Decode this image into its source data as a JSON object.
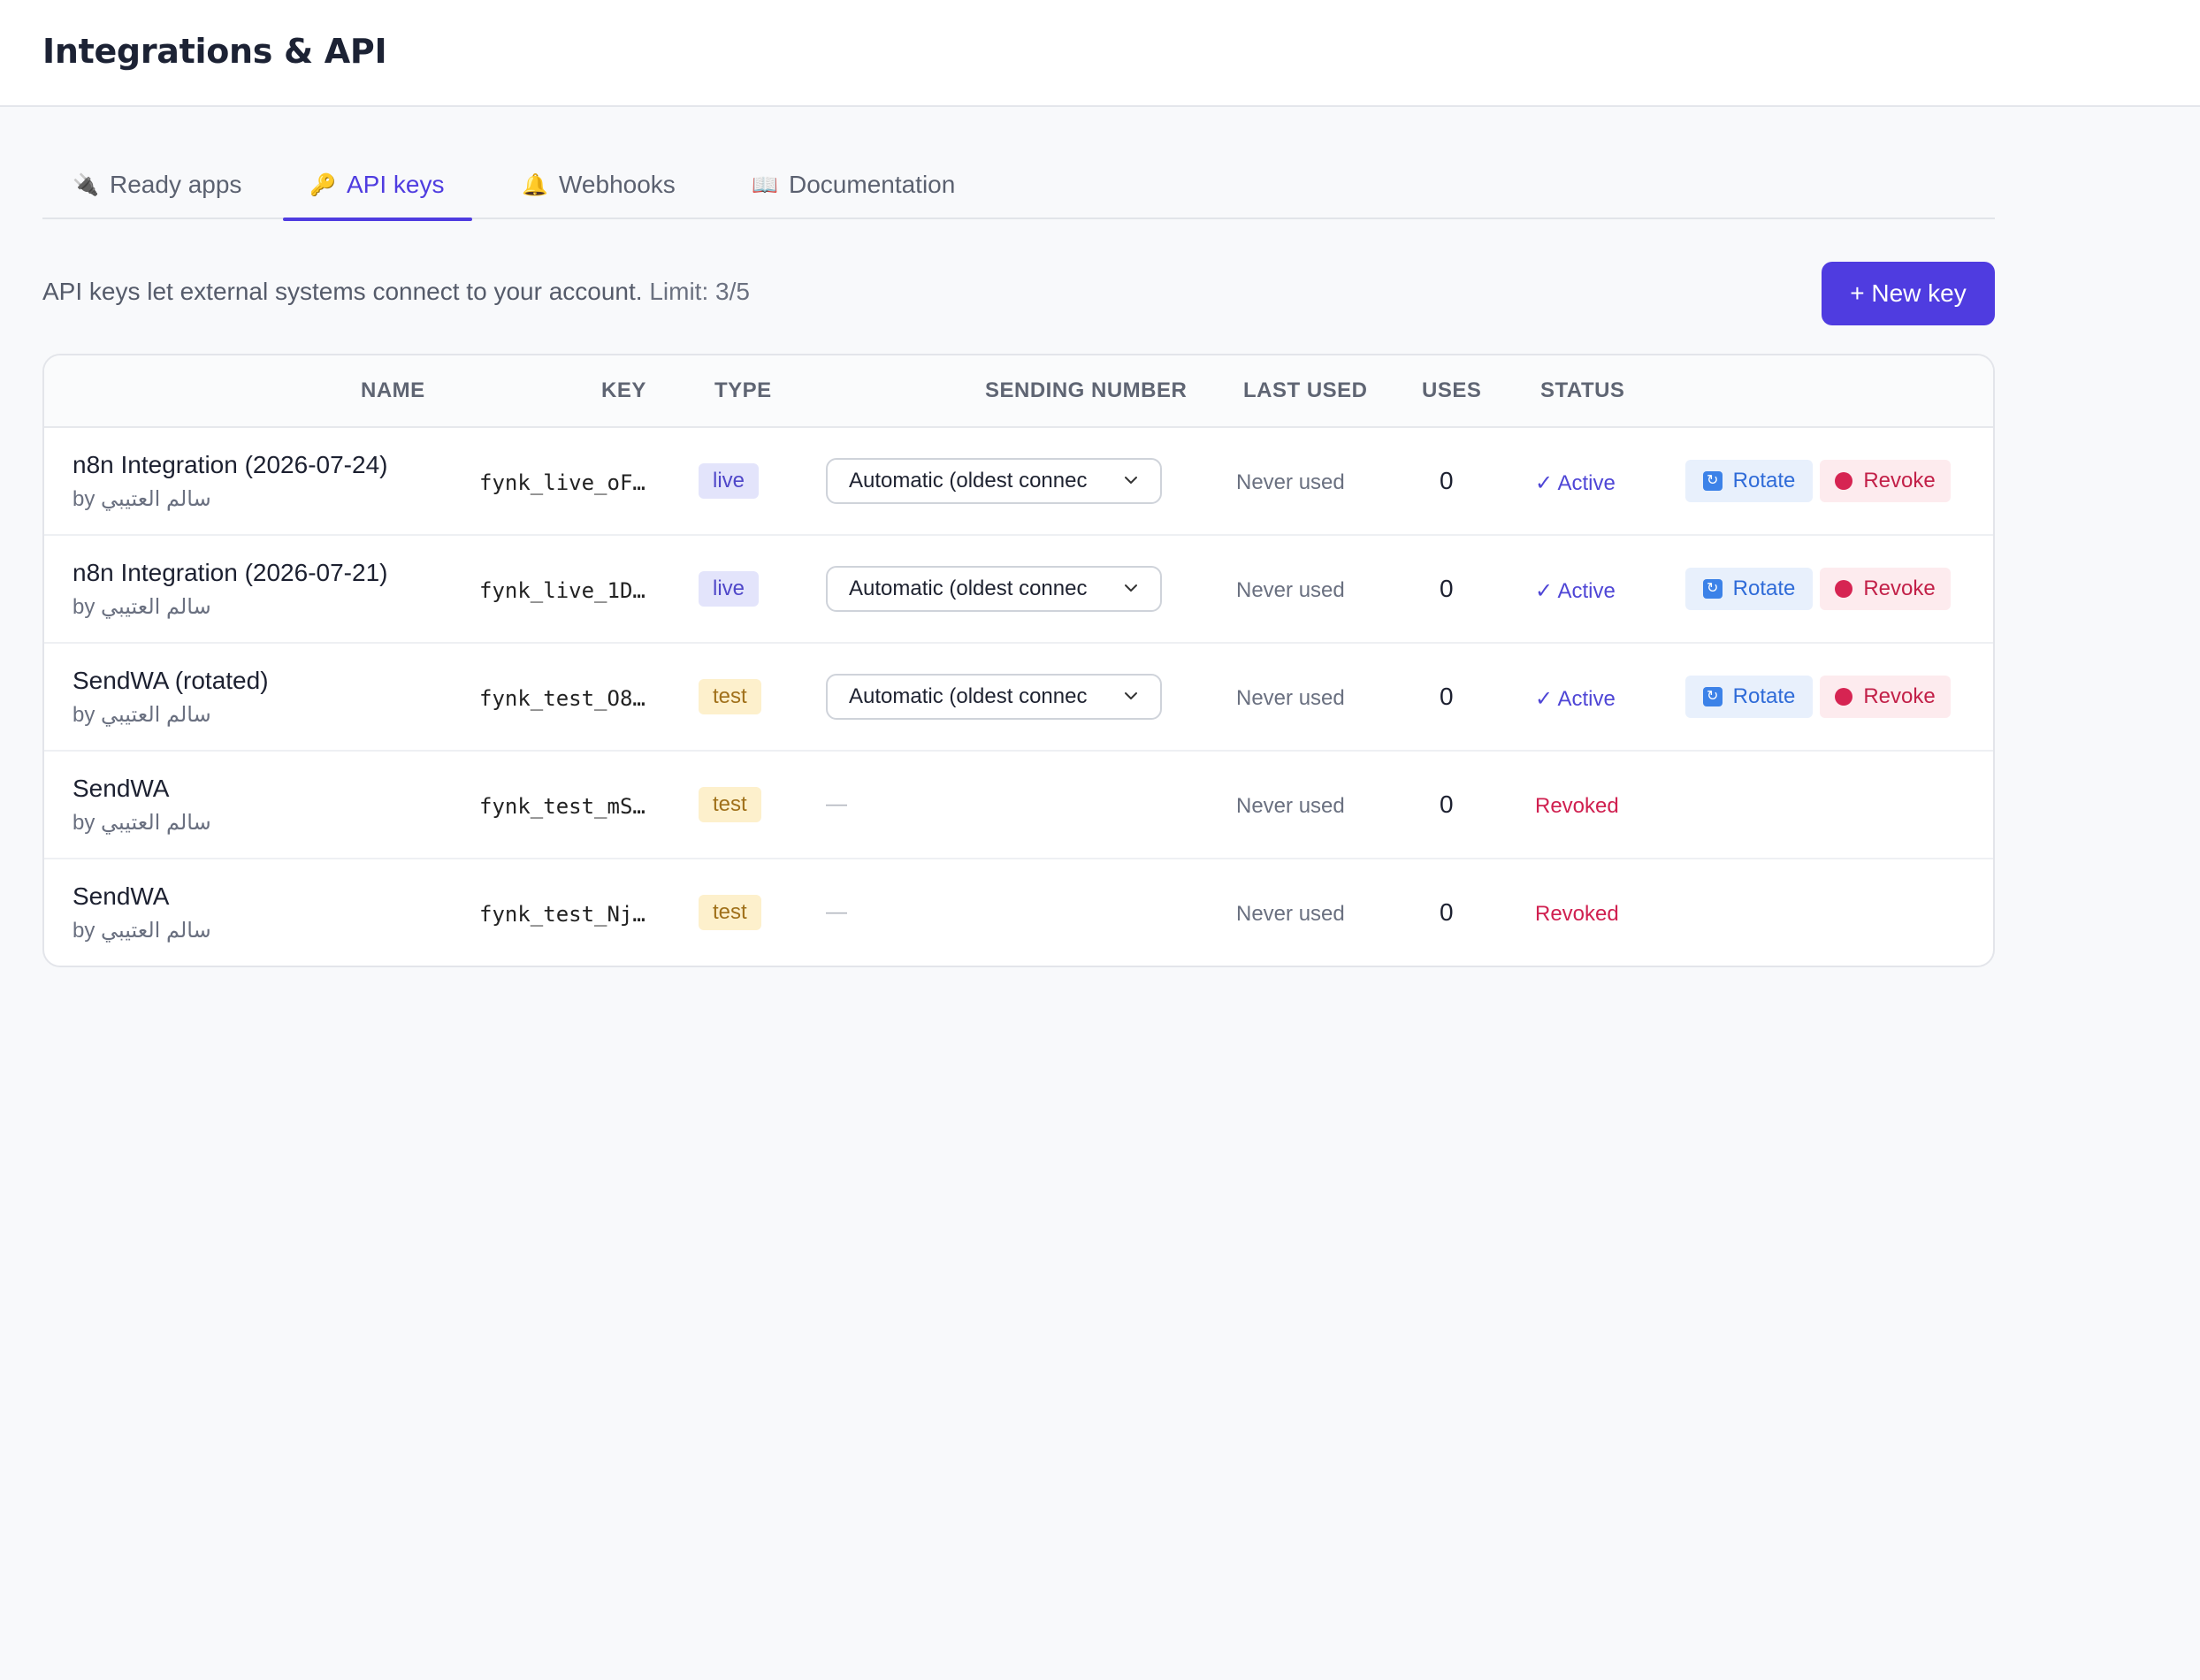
{
  "header": {
    "title": "Integrations & API"
  },
  "tabs": [
    {
      "icon": "plug-icon",
      "glyph": "🔌",
      "label": "Ready apps",
      "active": false
    },
    {
      "icon": "key-icon",
      "glyph": "🔑",
      "label": "API keys",
      "active": true
    },
    {
      "icon": "bell-icon",
      "glyph": "🔔",
      "label": "Webhooks",
      "active": false
    },
    {
      "icon": "book-icon",
      "glyph": "📖",
      "label": "Documentation",
      "active": false
    }
  ],
  "intro": {
    "text": "API keys let external systems connect to your account.",
    "limit": "Limit: 3/5"
  },
  "new_key_button": "+ New key",
  "table": {
    "headers": {
      "name": "NAME",
      "key": "KEY",
      "type": "TYPE",
      "sending_number": "SENDING NUMBER",
      "last_used": "LAST USED",
      "uses": "USES",
      "status": "STATUS"
    },
    "rows": [
      {
        "name": "n8n Integration (2026-07-24)",
        "by": "by سالم العتيبي",
        "key": "fynk_live_oF…",
        "type": "live",
        "sending_number": "Automatic (oldest connec",
        "last_used": "Never used",
        "uses": "0",
        "status": "✓ Active",
        "rotate": "Rotate",
        "revoke": "Revoke"
      },
      {
        "name": "n8n Integration (2026-07-21)",
        "by": "by سالم العتيبي",
        "key": "fynk_live_1D…",
        "type": "live",
        "sending_number": "Automatic (oldest connec",
        "last_used": "Never used",
        "uses": "0",
        "status": "✓ Active",
        "rotate": "Rotate",
        "revoke": "Revoke"
      },
      {
        "name": "SendWA (rotated)",
        "by": "by سالم العتيبي",
        "key": "fynk_test_O8…",
        "type": "test",
        "sending_number": "Automatic (oldest connec",
        "last_used": "Never used",
        "uses": "0",
        "status": "✓ Active",
        "rotate": "Rotate",
        "revoke": "Revoke"
      },
      {
        "name": "SendWA",
        "by": "by سالم العتيبي",
        "key": "fynk_test_mS…",
        "type": "test",
        "sending_number": "—",
        "last_used": "Never used",
        "uses": "0",
        "status": "Revoked"
      },
      {
        "name": "SendWA",
        "by": "by سالم العتيبي",
        "key": "fynk_test_Nj…",
        "type": "test",
        "sending_number": "—",
        "last_used": "Never used",
        "uses": "0",
        "status": "Revoked"
      }
    ]
  },
  "colors": {
    "accent": "#4f3ce0",
    "active_status": "#4f46d6",
    "revoked_status": "#d02050",
    "live_badge_bg": "#e3e4fb",
    "test_badge_bg": "#fdf0cc"
  }
}
